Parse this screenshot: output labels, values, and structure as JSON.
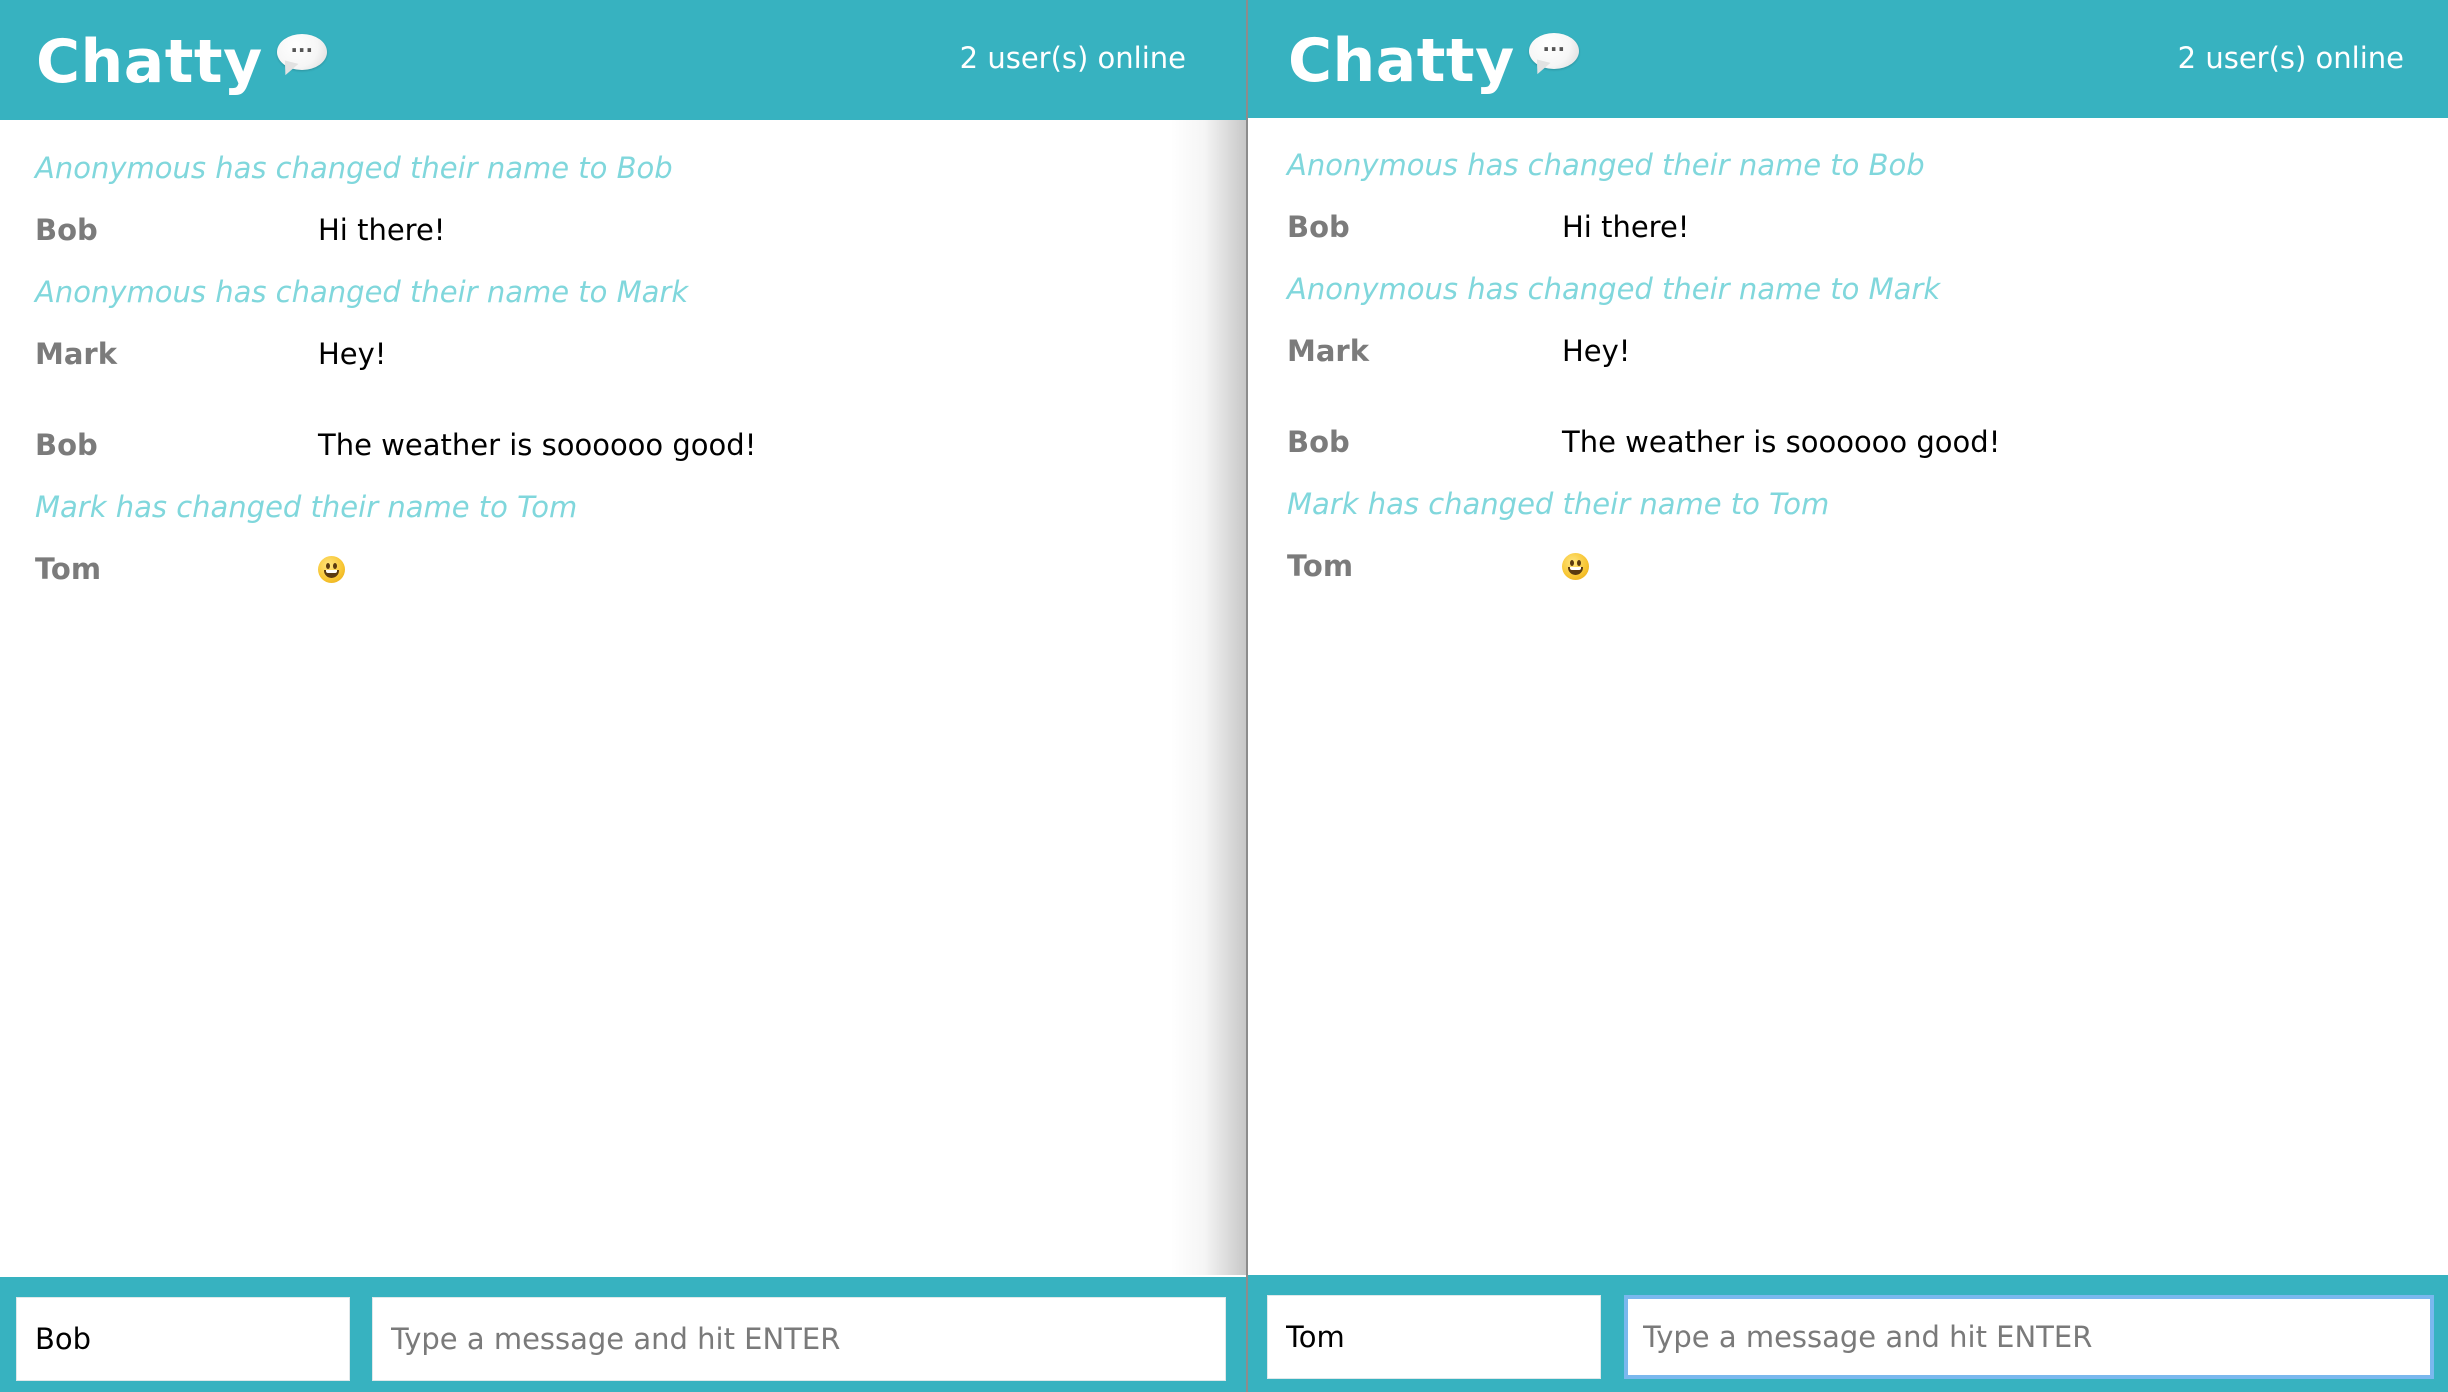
{
  "colors": {
    "brand_teal": "#37b2c0",
    "system_text": "#80d7dc",
    "username_text": "#7b7b7b",
    "content_text": "#000000",
    "focus_ring": "#7ab8ee"
  },
  "windows": [
    {
      "navbar": {
        "brand": "Chatty",
        "brand_icon": "speech-bubble-icon",
        "online_count": "2 user(s) online"
      },
      "messages": [
        {
          "type": "system",
          "text": "Anonymous has changed their name to Bob"
        },
        {
          "type": "message",
          "username": "Bob",
          "content": "Hi there!"
        },
        {
          "type": "system",
          "text": "Anonymous has changed their name to Mark"
        },
        {
          "type": "message",
          "username": "Mark",
          "content": "Hey!"
        },
        {
          "type": "message",
          "username": "Bob",
          "content": "The weather is soooooo good!"
        },
        {
          "type": "system",
          "text": "Mark has changed their name to Tom"
        },
        {
          "type": "message",
          "username": "Tom",
          "content": "",
          "emoji": "grinning-face-emoji"
        }
      ],
      "footer": {
        "username_value": "Bob",
        "message_placeholder": "Type a message and hit ENTER",
        "message_value": ""
      }
    },
    {
      "navbar": {
        "brand": "Chatty",
        "brand_icon": "speech-bubble-icon",
        "online_count": "2 user(s) online"
      },
      "messages": [
        {
          "type": "system",
          "text": "Anonymous has changed their name to Bob"
        },
        {
          "type": "message",
          "username": "Bob",
          "content": "Hi there!"
        },
        {
          "type": "system",
          "text": "Anonymous has changed their name to Mark"
        },
        {
          "type": "message",
          "username": "Mark",
          "content": "Hey!"
        },
        {
          "type": "message",
          "username": "Bob",
          "content": "The weather is soooooo good!"
        },
        {
          "type": "system",
          "text": "Mark has changed their name to Tom"
        },
        {
          "type": "message",
          "username": "Tom",
          "content": "",
          "emoji": "grinning-face-emoji"
        }
      ],
      "footer": {
        "username_value": "Tom",
        "message_placeholder": "Type a message and hit ENTER",
        "message_value": "",
        "message_focused": true
      }
    }
  ]
}
